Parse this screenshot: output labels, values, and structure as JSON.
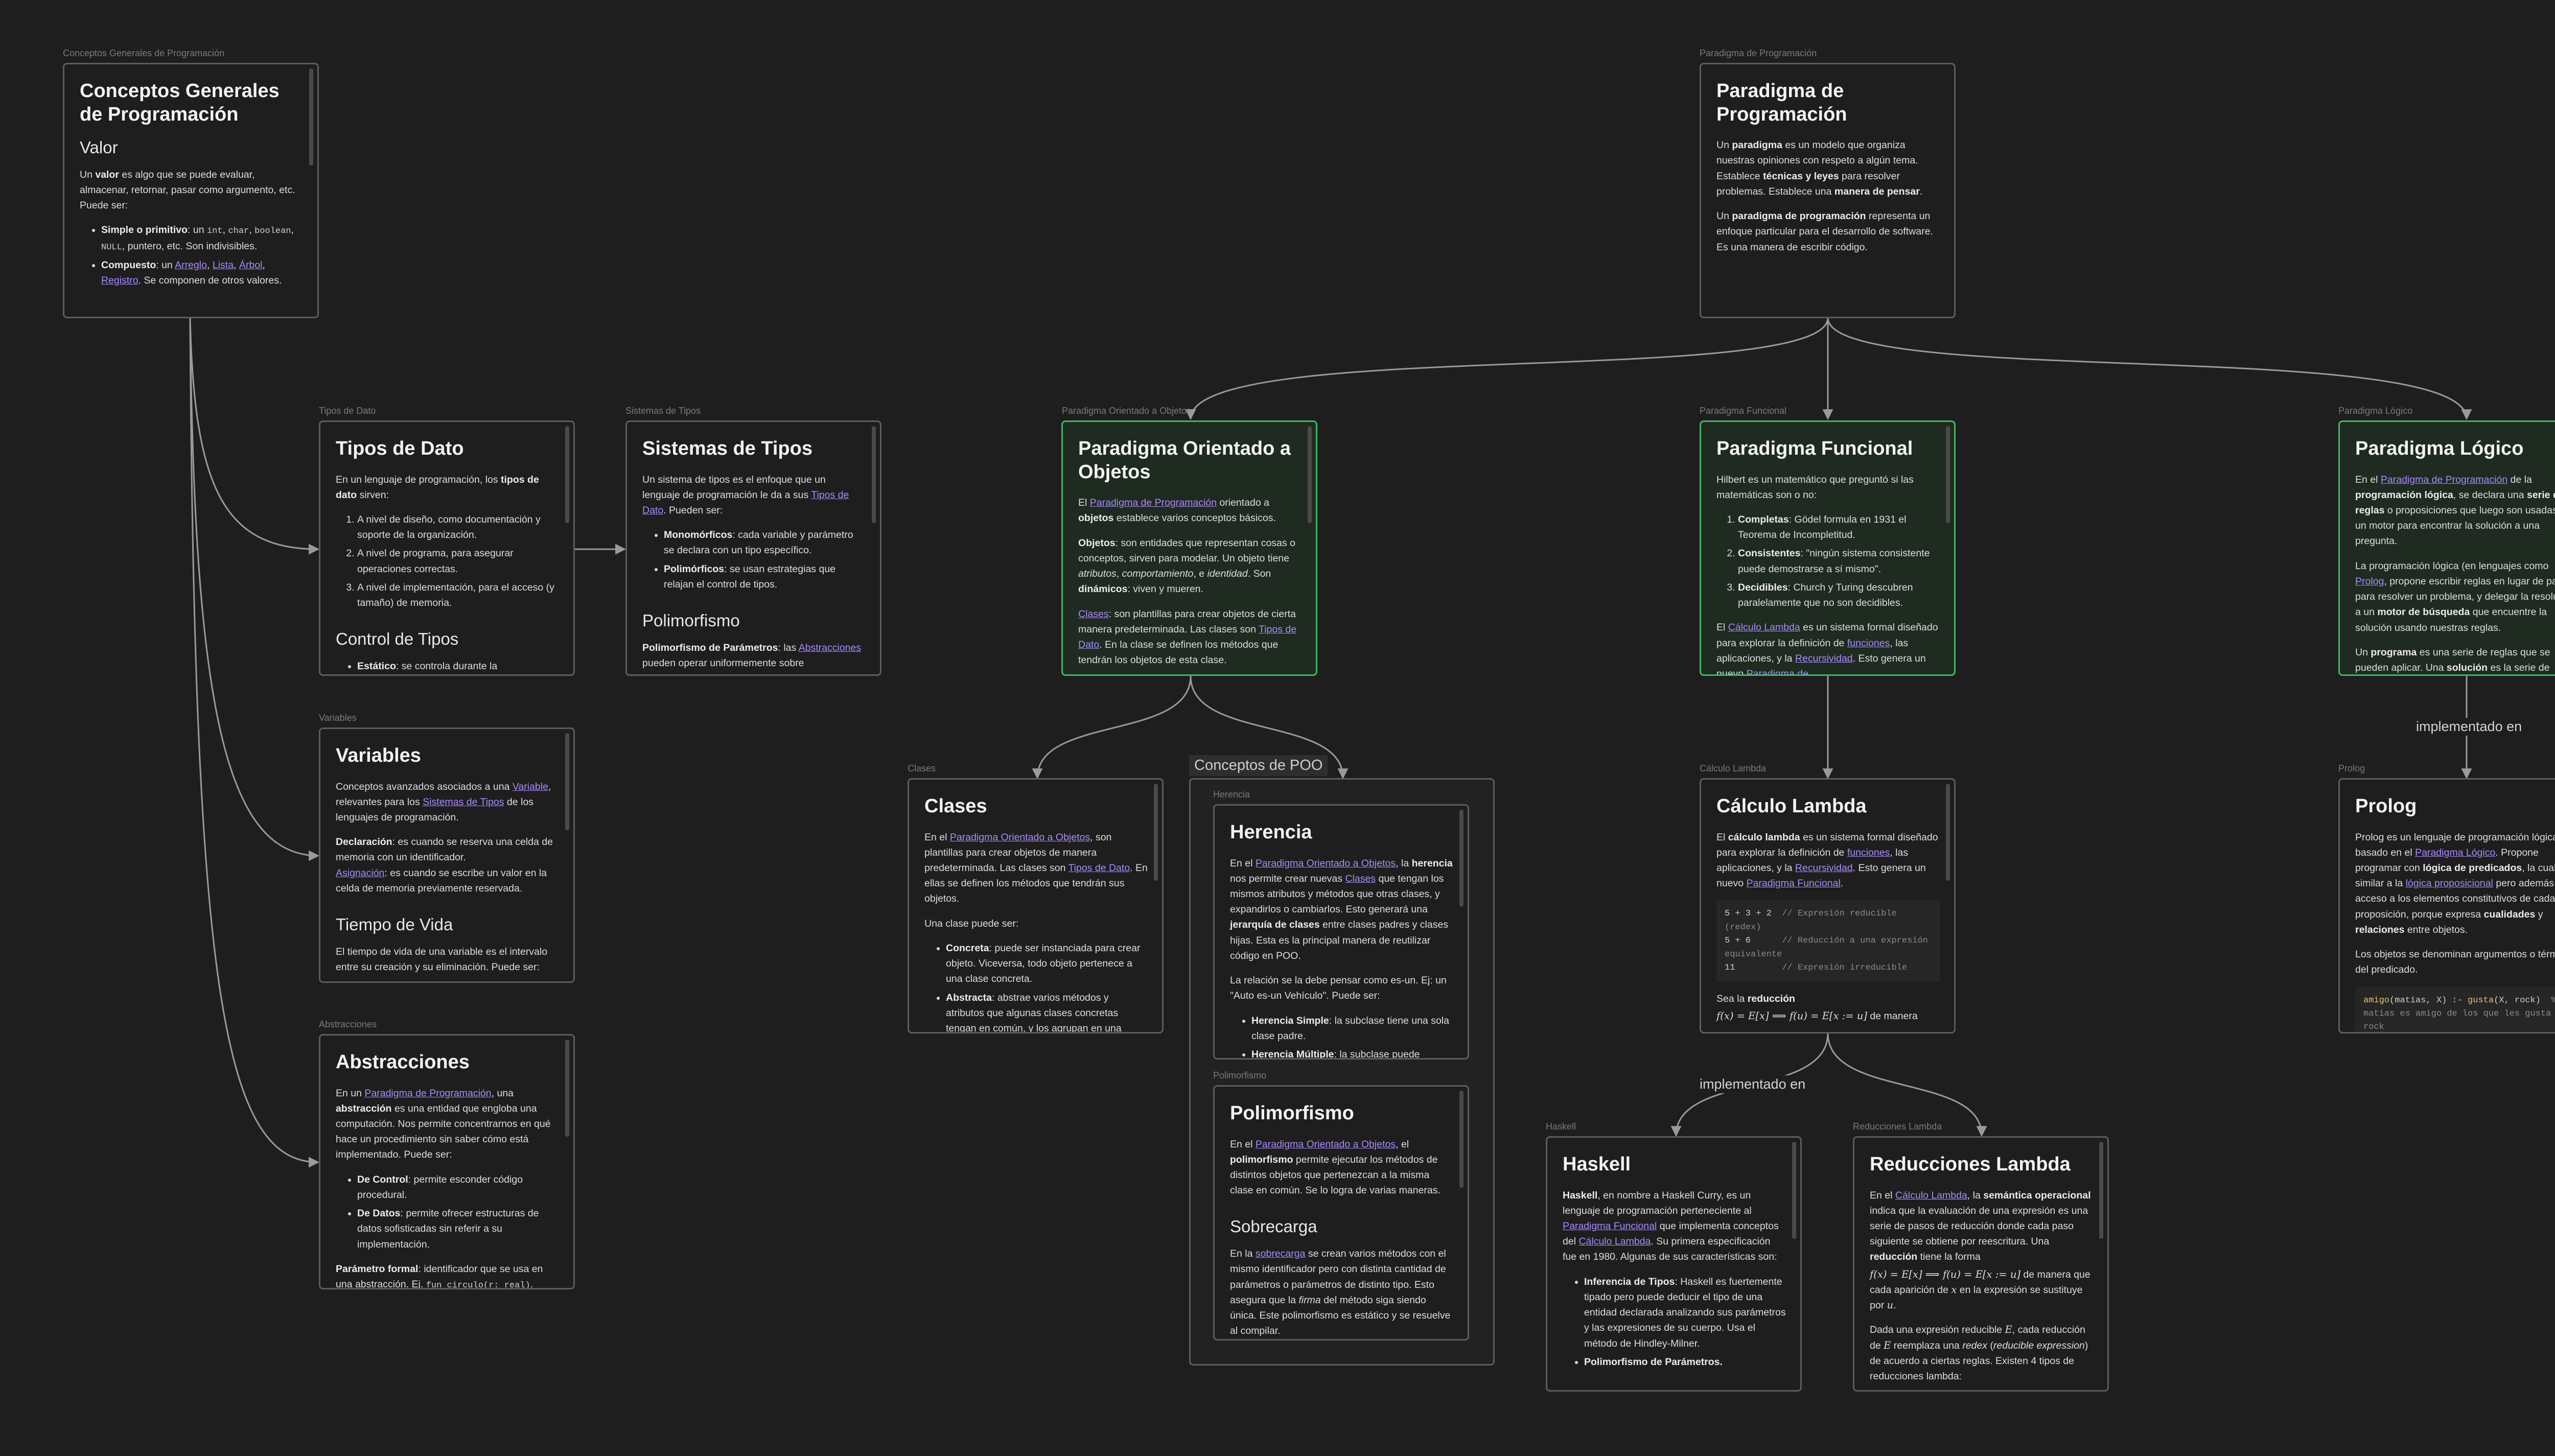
{
  "edges": {
    "implementado_en_prolog": "implementado en",
    "implementado_en_haskell": "implementado en"
  },
  "groups": {
    "conceptos_poo": "Conceptos de POO"
  },
  "cards": {
    "conceptos": {
      "label": "Conceptos Generales de Programación",
      "title": "Conceptos Generales de Programación",
      "h_valor": "Valor",
      "p1": [
        "Un ",
        "valor",
        " es algo que se puede evaluar, almacenar, retornar, pasar como argumento, etc. Puede ser:"
      ],
      "li1": [
        "Simple o primitivo",
        ": un ",
        "int",
        ", ",
        "char",
        ", ",
        "boolean",
        ", ",
        "NULL",
        ", puntero, etc. Son indivisibles."
      ],
      "li2": [
        "Compuesto",
        ": un ",
        "Arreglo",
        ", ",
        "Lista",
        ", ",
        "Árbol",
        ", ",
        "Registro",
        ". Se componen de otros valores."
      ]
    },
    "paradigma": {
      "label": "Paradigma de Programación",
      "title": "Paradigma de Programación",
      "p1": [
        "Un ",
        "paradigma",
        " es un modelo que organiza nuestras opiniones con respeto a algún tema. Establece ",
        "técnicas y leyes",
        " para resolver problemas. Establece una ",
        "manera de pensar",
        "."
      ],
      "p2": [
        "Un ",
        "paradigma de programación",
        " representa un enfoque particular para el desarrollo de software. Es una manera de escribir código."
      ]
    },
    "tipos": {
      "label": "Tipos de Dato",
      "title": "Tipos de Dato",
      "p1": [
        "En un lenguaje de programación, los ",
        "tipos de dato",
        " sirven:"
      ],
      "items": [
        "A nivel de diseño, como documentación y soporte de la organización.",
        "A nivel de programa, para asegurar operaciones correctas.",
        "A nivel de implementación, para el acceso (y tamaño) de memoria."
      ],
      "h2": "Control de Tipos",
      "li_cut": [
        "Estático",
        ": se controla durante la"
      ]
    },
    "sistemas": {
      "label": "Sistemas de Tipos",
      "title": "Sistemas de Tipos",
      "p1": [
        "Un sistema de tipos es el enfoque que un lenguaje de programación le da a sus ",
        "Tipos de Dato",
        ". Pueden ser:"
      ],
      "li1": [
        "Monomórficos",
        ": cada variable y parámetro se declara con un tipo específico."
      ],
      "li2": [
        "Polimórficos",
        ": se usan estrategias que relajan el control de tipos."
      ],
      "h2": "Polimorfismo",
      "p2": [
        "Polimorfismo de Parámetros",
        ": las ",
        "Abstracciones",
        " pueden operar uniformemente sobre"
      ]
    },
    "poo": {
      "label": "Paradigma Orientado a Objetos",
      "title": "Paradigma Orientado a Objetos",
      "p1": [
        "El ",
        "Paradigma de Programación",
        " orientado a ",
        "objetos",
        " establece varios conceptos básicos."
      ],
      "p2": [
        "Objetos",
        ": son entidades que representan cosas o conceptos, sirven para modelar. Un objeto tiene ",
        "atributos",
        ", ",
        "comportamiento",
        ", e ",
        "identidad",
        ". Son ",
        "dinámicos",
        ": viven y mueren."
      ],
      "p3": [
        "Clases",
        ": son plantillas para crear objetos de cierta manera predeterminada. Las clases son ",
        "Tipos de Dato",
        ". En la clase se definen los métodos que tendrán los objetos de esta clase."
      ]
    },
    "funcional": {
      "label": "Paradigma Funcional",
      "title": "Paradigma Funcional",
      "p1": "Hilbert es un matemático que preguntó si las matemáticas son o no:",
      "li1": [
        "Completas",
        ": Gödel formula en 1931 el Teorema de Incompletitud."
      ],
      "li2": [
        "Consistentes",
        ": \"ningún sistema consistente puede demostrarse a sí mismo\"."
      ],
      "li3": [
        "Decidibles",
        ": Church y Turing descubren paralelamente que no son decidibles."
      ],
      "p2": [
        "El ",
        "Cálculo Lambda",
        " es un sistema formal diseñado para explorar la definición de ",
        "funciones",
        ", las aplicaciones, y la ",
        "Recursividad",
        ". Esto genera un nuevo ",
        "Paradigma de"
      ]
    },
    "logico": {
      "label": "Paradigma Lógico",
      "title": "Paradigma Lógico",
      "p1": [
        "En el ",
        "Paradigma de Programación",
        " de la ",
        "programación lógica",
        ", se declara una ",
        "serie de reglas",
        " o proposiciones que luego son usadas por un motor para encontrar la solución a una pregunta."
      ],
      "p2": [
        "La programación lógica (en lenguajes como ",
        "Prolog",
        ", propone escribir reglas en lugar de pasos para resolver un problema, y delegar la resolución a un ",
        "motor de búsqueda",
        " que encuentre la solución usando nuestras reglas."
      ],
      "p3": [
        "Un ",
        "programa",
        " es una serie de reglas que se pueden aplicar. Una ",
        "solución",
        " es la serie de"
      ]
    },
    "variables": {
      "label": "Variables",
      "title": "Variables",
      "p1": [
        "Conceptos avanzados asociados a una ",
        "Variable",
        ", relevantes para los ",
        "Sistemas de Tipos",
        " de los lenguajes de programación."
      ],
      "p2": [
        "Declaración",
        ": es cuando se reserva una celda de memoria con un identificador."
      ],
      "p3": [
        "Asignación",
        ": es cuando se escribe un valor en la celda de memoria previamente reservada."
      ],
      "h2": "Tiempo de Vida",
      "p4": "El tiempo de vida de una variable es el intervalo entre su creación y su eliminación. Puede ser:"
    },
    "clases": {
      "label": "Clases",
      "title": "Clases",
      "p1": [
        "En el ",
        "Paradigma Orientado a Objetos",
        ", son plantillas para crear objetos de manera predeterminada. Las clases son ",
        "Tipos de Dato",
        ". En ellas se definen los métodos que tendrán sus objetos."
      ],
      "p2": "Una clase puede ser:",
      "li1": [
        "Concreta",
        ": puede ser instanciada para crear objeto. Viceversa, todo objeto pertenece a una clase concreta."
      ],
      "li2": [
        "Abstracta",
        ": abstrae varios métodos y atributos que algunas clases concretas tengan en común, y los agrupan en una"
      ]
    },
    "herencia": {
      "label": "Herencia",
      "title": "Herencia",
      "p1": [
        "En el ",
        "Paradigma Orientado a Objetos",
        ", la ",
        "herencia",
        " nos permite crear nuevas ",
        "Clases",
        " que tengan los mismos atributos y métodos que otras clases, y expandirlos o cambiarlos. Esto generará una ",
        "jerarquía de clases",
        " entre clases padres y clases hijas. Esta es la principal manera de reutilizar código en POO."
      ],
      "p2": "La relación se la debe pensar como es-un. Ej: un \"Auto es-un Vehículo\". Puede ser:",
      "li1": [
        "Herencia Simple",
        ": la subclase tiene una sola clase padre."
      ],
      "li2": [
        "Herencia Múltiple",
        ": la subclase puede"
      ]
    },
    "polimorfismo": {
      "label": "Polimorfismo",
      "title": "Polimorfismo",
      "p1": [
        "En el ",
        "Paradigma Orientado a Objetos",
        ", el ",
        "polimorfismo",
        " permite ejecutar los métodos de distintos objetos que pertenezcan a la misma clase en común. Se lo logra de varias maneras."
      ],
      "h2": "Sobrecarga",
      "p2": [
        "En la ",
        "sobrecarga",
        " se crean varios métodos con el mismo identificador pero con distinta cantidad de parámetros o parámetros de distinto tipo. Esto asegura que la ",
        "firma",
        " del método siga siendo única. Este polimorfismo es estático y se resuelve al compilar."
      ]
    },
    "lambda": {
      "label": "Cálculo Lambda",
      "title": "Cálculo Lambda",
      "p1": [
        "El ",
        "cálculo lambda",
        " es un sistema formal diseñado para explorar la definición de ",
        "funciones",
        ", las aplicaciones, y la ",
        "Recursividad",
        ". Esto genera un nuevo ",
        "Paradigma Funcional",
        "."
      ],
      "code": [
        [
          "5 + 3 + 2",
          "  // Expresión reducible (redex)"
        ],
        [
          "5 + 6",
          "      // Reducción a una expresión equivalente"
        ],
        [
          "11",
          "         // Expresión irreducible"
        ]
      ],
      "p2": [
        "Sea la ",
        "reducción"
      ],
      "math": [
        "f(x) = E[x] ⟹ f(u) = E[x := u]",
        " de manera"
      ]
    },
    "prolog": {
      "label": "Prolog",
      "title": "Prolog",
      "p1": [
        "Prolog es un lenguaje de programación lógica basado en el ",
        "Paradigma Lógico",
        ". Propone programar con ",
        "lógica de predicados",
        ", la cual es similar a la ",
        "lógica proposicional",
        " pero además tiene acceso a los elementos constitutivos de cada proposición, porque expresa ",
        "cualidades",
        " y ",
        "relaciones",
        " entre objetos."
      ],
      "p2": "Los objetos se denominan argumentos o términos del predicado.",
      "code": [
        "amigo",
        "(matias, X) :- ",
        "gusta",
        "(X, rock)",
        "  % matias es amigo de los que les gusta el rock"
      ]
    },
    "abstracciones": {
      "label": "Abstracciones",
      "title": "Abstracciones",
      "p1": [
        "En un ",
        "Paradigma de Programación",
        ", una ",
        "abstracción",
        " es una entidad que engloba una computación. Nos permite concentrarnos en qué hace un procedimiento sin saber cómo está implementado. Puede ser:"
      ],
      "li1": [
        "De Control",
        ": permite esconder código procedural."
      ],
      "li2": [
        "De Datos",
        ": permite ofrecer estructuras de datos sofisticadas sin referir a su implementación."
      ],
      "p2": [
        "Parámetro formal",
        ": identificador que se usa en una abstracción. Ej. ",
        "fun circulo(r: real)",
        "."
      ]
    },
    "haskell": {
      "label": "Haskell",
      "title": "Haskell",
      "p1": [
        "Haskell",
        ", en nombre a Haskell Curry, es un lenguaje de programación perteneciente al ",
        "Paradigma Funcional",
        " que implementa conceptos del ",
        "Cálculo Lambda",
        ". Su primera especificación fue en 1980. Algunas de sus características son:"
      ],
      "li1": [
        "Inferencia de Tipos",
        ": Haskell es fuertemente tipado pero puede deducir el tipo de una entidad declarada analizando sus parámetros y las expresiones de su cuerpo. Usa el método de Hindley-Milner."
      ],
      "li2": "Polimorfismo de Parámetros."
    },
    "reducciones": {
      "label": "Reducciones Lambda",
      "title": "Reducciones Lambda",
      "p1": [
        "En el ",
        "Cálculo Lambda",
        ", la ",
        "semántica operacional",
        " indica que la evaluación de una expresión es una serie de pasos de reducción donde cada paso siguiente se obtiene por reescritura. Una ",
        "reducción",
        " tiene la forma"
      ],
      "math1": [
        "f(x) = E[x] ⟹ f(u) = E[x := u]",
        " de manera que cada aparición de ",
        "x",
        " en la expresión se sustituye por ",
        "u",
        "."
      ],
      "p2": [
        "Dada una expresión reducible ",
        "E",
        ", cada reducción de ",
        "E",
        " reemplaza una ",
        "redex",
        " (",
        "reducible expression",
        ") de acuerdo a ciertas reglas. Existen 4 tipos de reducciones lambda:"
      ]
    }
  }
}
